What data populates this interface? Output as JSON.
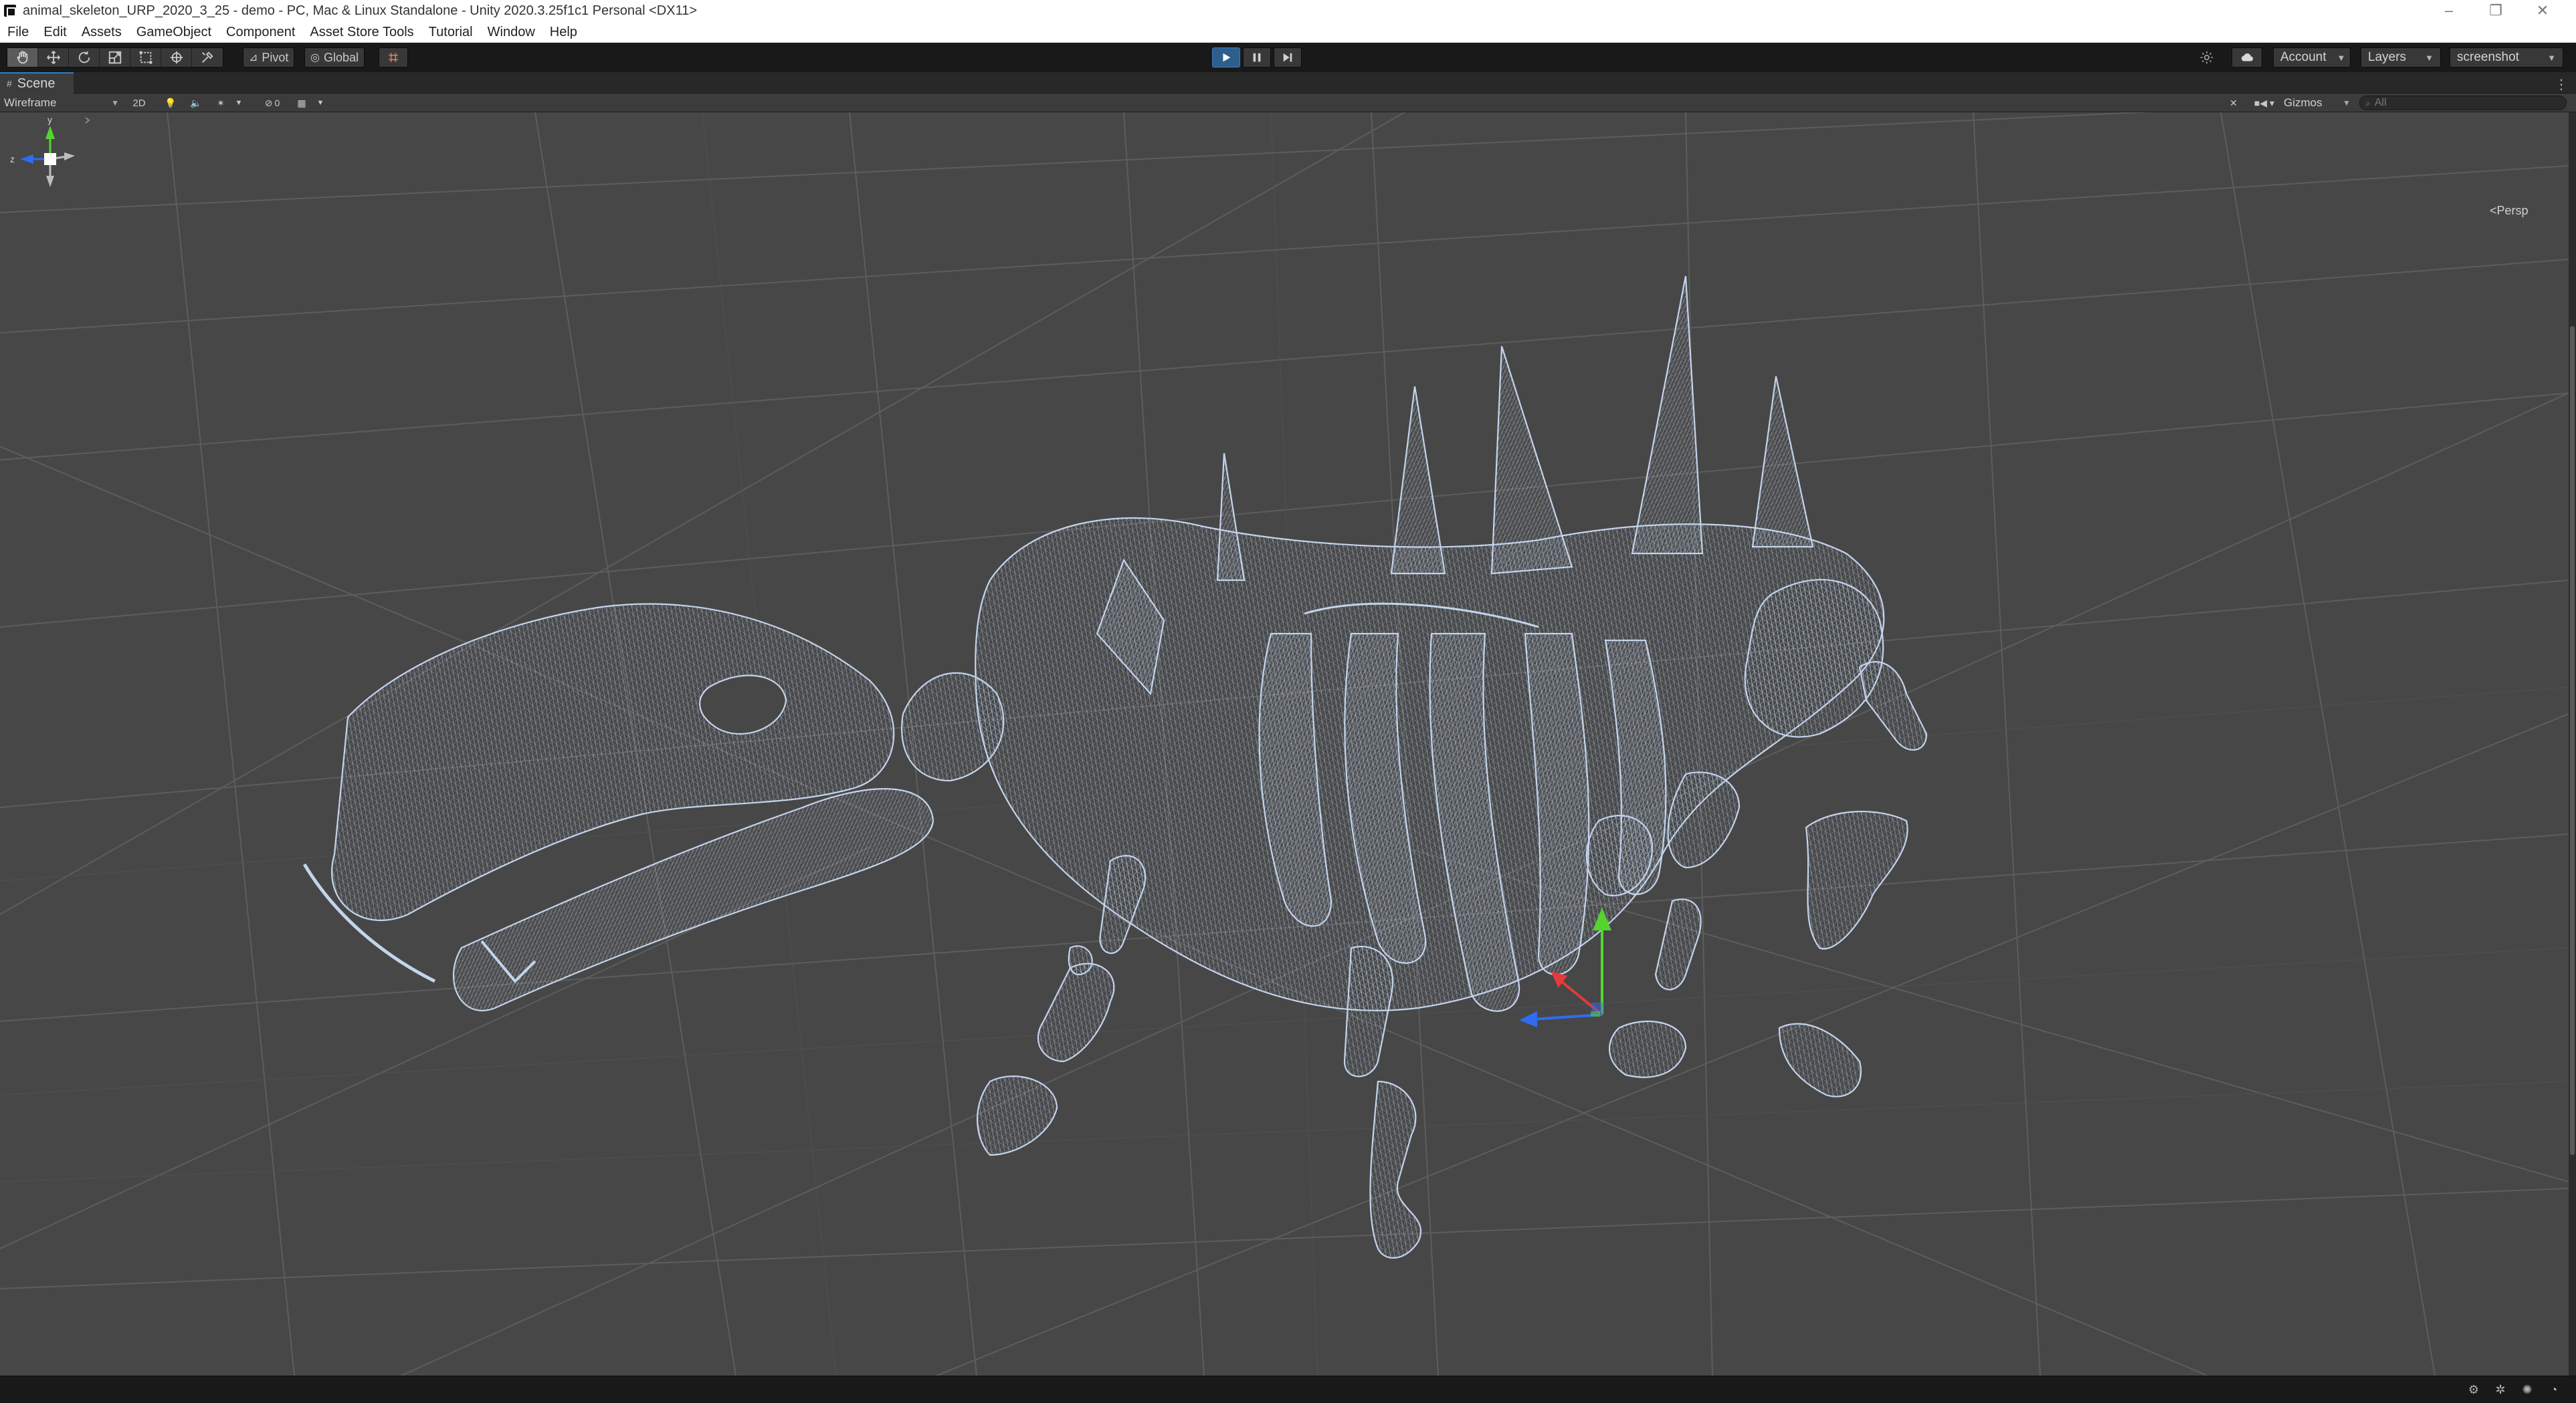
{
  "window": {
    "title": "animal_skeleton_URP_2020_3_25 - demo - PC, Mac & Linux Standalone - Unity 2020.3.25f1c1 Personal <DX11>",
    "minimize": "–",
    "restore": "❐",
    "close": "✕"
  },
  "menubar": {
    "items": [
      "File",
      "Edit",
      "Assets",
      "GameObject",
      "Component",
      "Asset Store Tools",
      "Tutorial",
      "Window",
      "Help"
    ]
  },
  "toolbar": {
    "tools": [
      "hand-tool-icon",
      "move-tool-icon",
      "rotate-tool-icon",
      "scale-tool-icon",
      "rect-tool-icon",
      "transform-tool-icon",
      "custom-tool-icon"
    ],
    "active_tool": "hand-tool-icon",
    "pivot_label": "Pivot",
    "global_label": "Global",
    "account_label": "Account",
    "layers_label": "Layers",
    "layout_label": "screenshot",
    "play_active": true
  },
  "scene": {
    "tab_label": "Scene",
    "shading_mode": "Wireframe",
    "mode_2d": "2D",
    "hidden_count": "0",
    "gizmos_label": "Gizmos",
    "search_placeholder": "All",
    "projection_label": "Persp",
    "axis_labels": {
      "y": "y",
      "z": "z"
    }
  },
  "colors": {
    "viewport_bg": "#474747",
    "wireframe": "#b9cbe4",
    "axis_x": "#e23b3b",
    "axis_y": "#55d430",
    "axis_z": "#2f6cf2",
    "play_active": "#2d5f8c"
  }
}
